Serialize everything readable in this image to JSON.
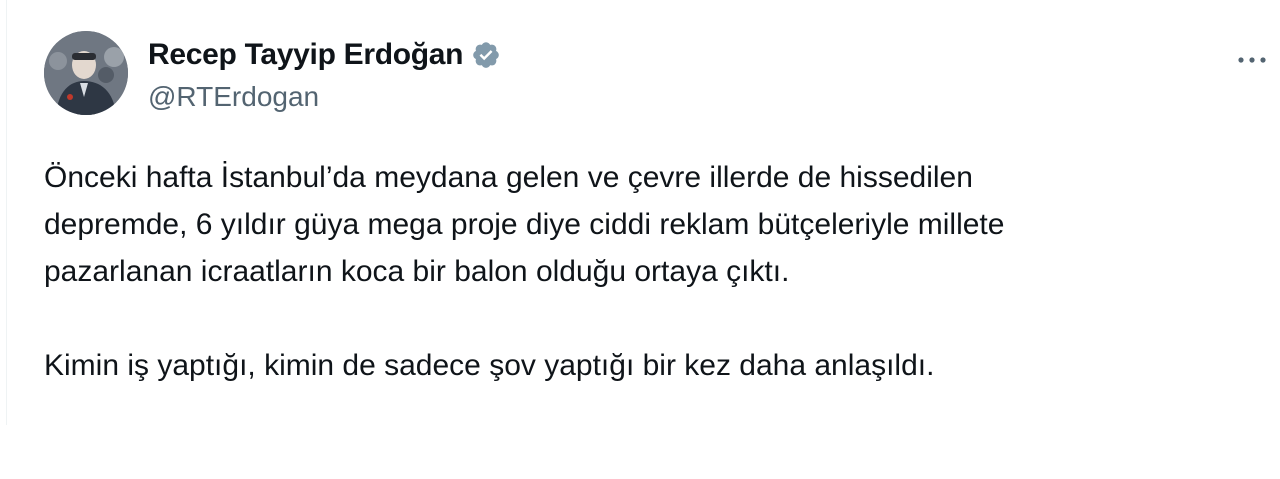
{
  "tweet": {
    "author": {
      "display_name": "Recep Tayyip Erdoğan",
      "handle": "@RTErdogan",
      "verified": true
    },
    "paragraphs": [
      "Önceki hafta İstanbul’da meydana gelen ve çevre illerde de hissedilen\ndepremde, 6 yıldır güya mega proje diye ciddi reklam bütçeleriyle millete\npazarlanan icraatların koca bir balon olduğu ortaya çıktı.",
      "Kimin iş yaptığı, kimin de sadece şov yaptığı bir kez daha anlaşıldı."
    ]
  },
  "icons": {
    "verified": "verified-badge-icon",
    "more": "more-dots-icon"
  },
  "colors": {
    "text": "#0f1419",
    "secondary_text": "#536471",
    "verified_badge": "#829aab",
    "divider": "#eff3f4"
  }
}
